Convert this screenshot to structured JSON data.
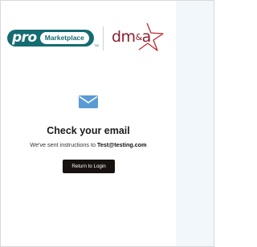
{
  "header": {
    "brand_primary": "pro",
    "brand_sub": "Marketplace",
    "brand_tm": "TM",
    "partner_brand": "dm",
    "partner_amp": "&",
    "partner_suffix": "a"
  },
  "main": {
    "icon": "envelope-icon",
    "title": "Check your email",
    "message_prefix": "We've sent instructions to ",
    "email": "Test@testing.com",
    "return_button_label": "Return to Login"
  },
  "colors": {
    "pro_brand": "#146c72",
    "partner_brand": "#8b1e2d",
    "partner_star": "#c1272d",
    "envelope": "#5b9bd5",
    "button_bg": "#17120f",
    "side_panel": "#f2f7fc"
  }
}
